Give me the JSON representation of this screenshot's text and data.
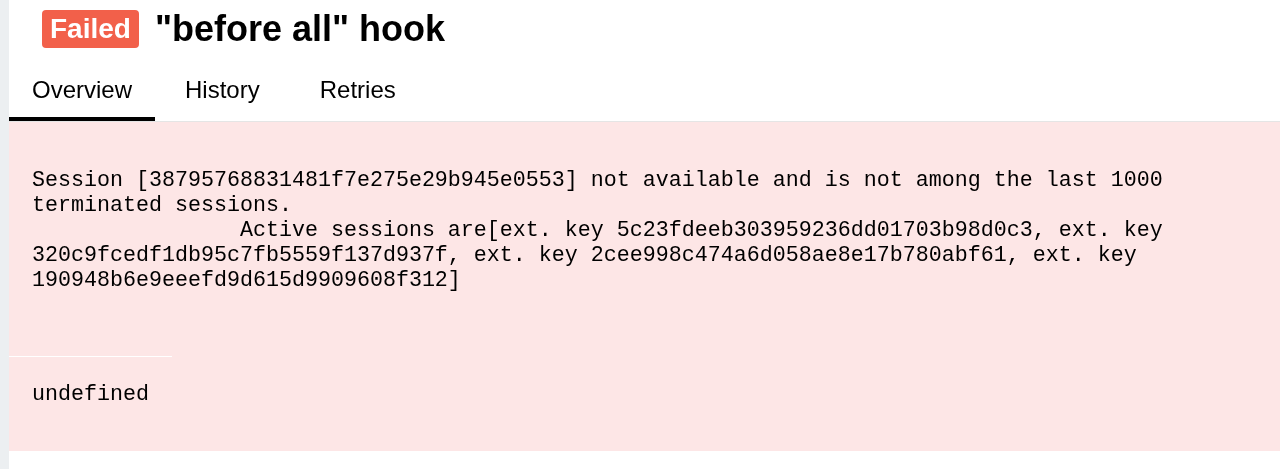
{
  "header": {
    "status": "Failed",
    "title": "\"before all\" hook"
  },
  "tabs": [
    {
      "label": "Overview",
      "selected": true
    },
    {
      "label": "History",
      "selected": false
    },
    {
      "label": "Retries",
      "selected": false
    }
  ],
  "error": {
    "message": "Session [38795768831481f7e275e29b945e0553] not available and is not among the last 1000 terminated sessions.\n                Active sessions are[ext. key 5c23fdeeb303959236dd01703b98d0c3, ext. key 320c9fcedf1db95c7fb5559f137d937f, ext. key 2cee998c474a6d058ae8e17b780abf61, ext. key 190948b6e9eeefd9d615d9909608f312]",
    "trace": "undefined"
  }
}
